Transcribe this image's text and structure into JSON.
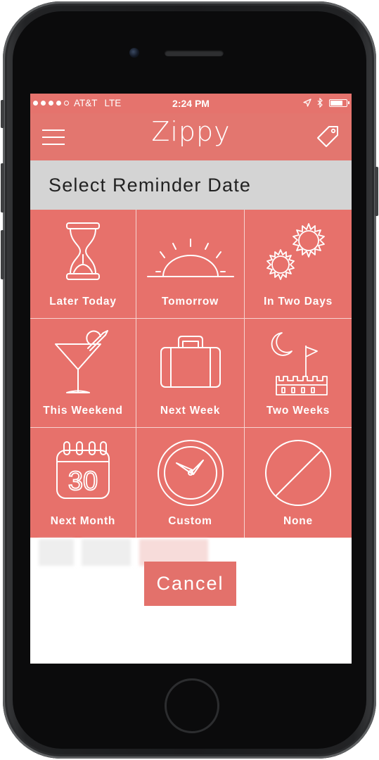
{
  "status_bar": {
    "carrier": "AT&T",
    "network": "LTE",
    "time": "2:24 PM"
  },
  "nav": {
    "title": "Zippy",
    "left_icon": "menu-icon",
    "right_icon": "tag-icon"
  },
  "header": {
    "title": "Select Reminder Date"
  },
  "options": [
    {
      "label": "Later Today",
      "icon": "hourglass-icon"
    },
    {
      "label": "Tomorrow",
      "icon": "sunrise-icon"
    },
    {
      "label": "In Two Days",
      "icon": "two-suns-icon"
    },
    {
      "label": "This Weekend",
      "icon": "cocktail-icon"
    },
    {
      "label": "Next Week",
      "icon": "suitcase-icon"
    },
    {
      "label": "Two Weeks",
      "icon": "castle-moon-icon"
    },
    {
      "label": "Next Month",
      "icon": "calendar-icon"
    },
    {
      "label": "Custom",
      "icon": "clock-icon"
    },
    {
      "label": "None",
      "icon": "none-icon"
    }
  ],
  "calendar_number": "30",
  "cancel_label": "Cancel",
  "colors": {
    "accent": "#e5736d",
    "header_bg": "#d4d4d4",
    "text_dark": "#222222"
  }
}
